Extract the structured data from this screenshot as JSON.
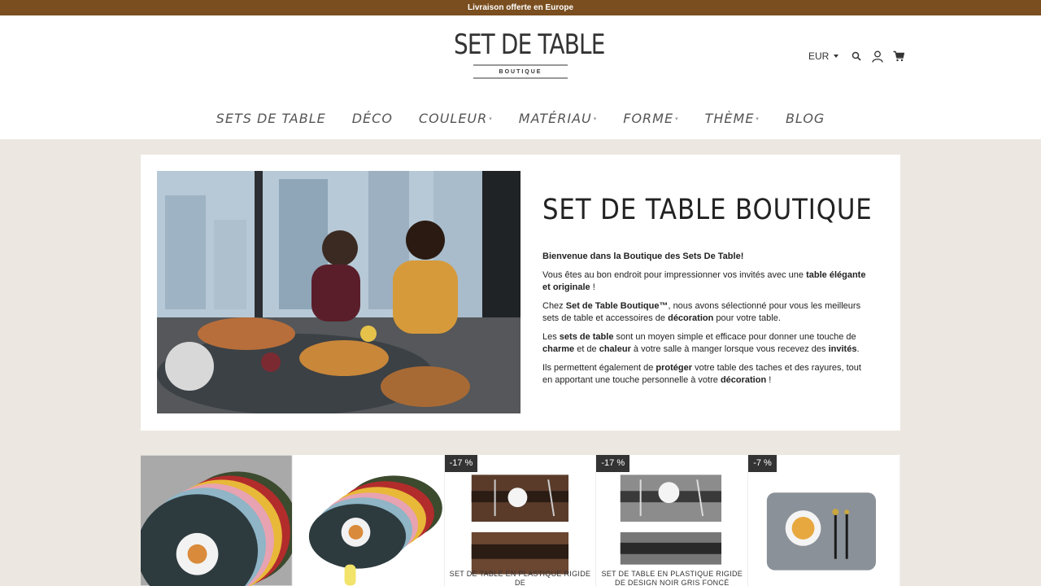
{
  "announcement": "Livraison offerte en Europe",
  "logo": {
    "title": "SET DE TABLE",
    "subtitle": "BOUTIQUE"
  },
  "header_tools": {
    "currency": "EUR"
  },
  "nav": [
    {
      "label": "SETS DE TABLE",
      "has_dropdown": false
    },
    {
      "label": "DÉCO",
      "has_dropdown": false
    },
    {
      "label": "COULEUR",
      "has_dropdown": true
    },
    {
      "label": "MATÉRIAU",
      "has_dropdown": true
    },
    {
      "label": "FORME",
      "has_dropdown": true
    },
    {
      "label": "THÈME",
      "has_dropdown": true
    },
    {
      "label": "BLOG",
      "has_dropdown": false
    }
  ],
  "hero": {
    "title": "SET DE TABLE BOUTIQUE",
    "p1_b": "Bienvenue dans la Boutique des Sets De Table!",
    "p2_a": "Vous êtes au bon endroit pour impressionner vos invités avec une ",
    "p2_b": "table élégante et originale",
    "p2_c": " !",
    "p3_a": "Chez ",
    "p3_b": "Set de Table Boutique™",
    "p3_c": ", nous avons sélectionné pour vous les meilleurs sets de table et accessoires de ",
    "p3_d": "décoration",
    "p3_e": " pour votre table.",
    "p4_a": "Les ",
    "p4_b": "sets de table",
    "p4_c": " sont un moyen simple et efficace pour donner une touche de ",
    "p4_d": "charme",
    "p4_e": " et de ",
    "p4_f": "chaleur",
    "p4_g": " à votre salle à manger lorsque vous recevez des ",
    "p4_h": "invités",
    "p4_i": ".",
    "p5_a": "Ils permettent également de ",
    "p5_b": "protéger",
    "p5_c": " votre table des taches et des rayures, tout en apportant une touche personnelle à votre ",
    "p5_d": "décoration",
    "p5_e": " !"
  },
  "products": [
    {
      "badge": "",
      "title": ""
    },
    {
      "badge": "",
      "title": ""
    },
    {
      "badge": "-17 %",
      "title": "SET DE TABLE EN PLASTIQUE RIGIDE DE"
    },
    {
      "badge": "-17 %",
      "title": "SET DE TABLE EN PLASTIQUE RIGIDE DE DESIGN NOIR GRIS FONCÉ"
    },
    {
      "badge": "-7 %",
      "title": ""
    }
  ],
  "colors": {
    "announcement_bg": "#7a4e1f",
    "page_bg": "#ece8e1",
    "badge_bg": "#333333"
  },
  "icons": [
    "search-icon",
    "account-icon",
    "cart-icon"
  ]
}
